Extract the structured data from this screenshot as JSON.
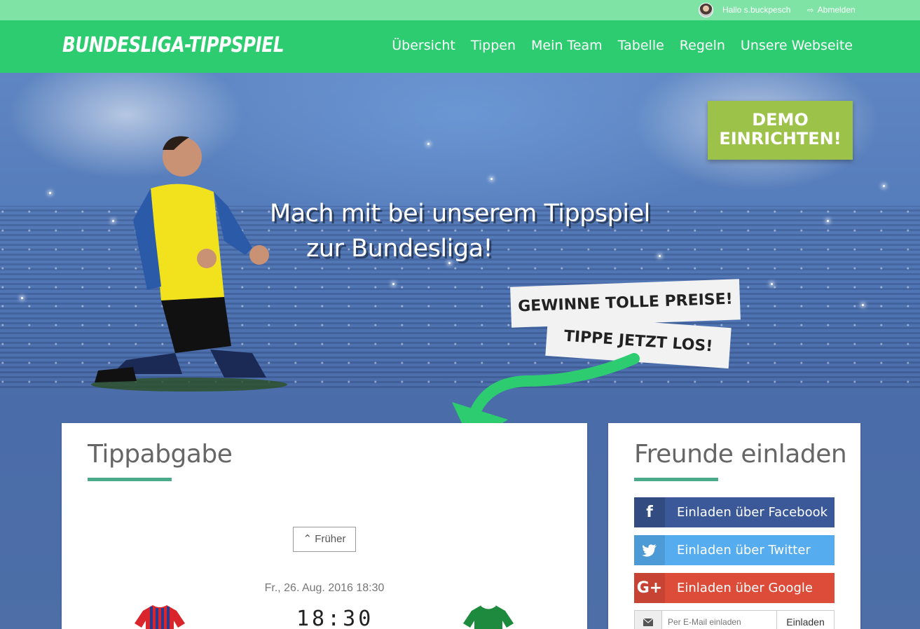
{
  "userbar": {
    "greeting": "Hallo s.buckpesch",
    "logout_label": "Abmelden"
  },
  "brand": "BUNDESLIGA-TIPPSPIEL",
  "nav": {
    "items": [
      "Übersicht",
      "Tippen",
      "Mein Team",
      "Tabelle",
      "Regeln",
      "Unsere Webseite"
    ]
  },
  "hero": {
    "title_line1": "Mach mit bei unserem Tippspiel",
    "title_line2": "zur Bundesliga!",
    "demo_line1": "DEMO",
    "demo_line2": "EINRICHTEN!",
    "tag1": "GEWINNE TOLLE PREISE!",
    "tag2": "TIPPE JETZT LOS!"
  },
  "tippabgabe": {
    "title": "Tippabgabe",
    "earlier_label": "Früher",
    "match_date": "Fr., 26. Aug. 2016 18:30",
    "match_time": "18:30"
  },
  "invite": {
    "title": "Freunde einladen",
    "facebook_label": "Einladen über Facebook",
    "twitter_label": "Einladen über Twitter",
    "google_label": "Einladen über Google",
    "email_placeholder": "Per E-Mail einladen",
    "email_button": "Einladen"
  },
  "colors": {
    "green": "#2ecc71",
    "demo_green": "#9dc24a",
    "facebook": "#3b5998",
    "twitter": "#55acee",
    "google": "#dd4b39",
    "accent_underline": "#4aaa8a"
  },
  "icons": [
    "user-avatar",
    "logout-icon",
    "facebook-icon",
    "twitter-icon",
    "google-plus-icon",
    "envelope-icon",
    "chevron-up-icon",
    "home-jersey",
    "away-jersey"
  ]
}
